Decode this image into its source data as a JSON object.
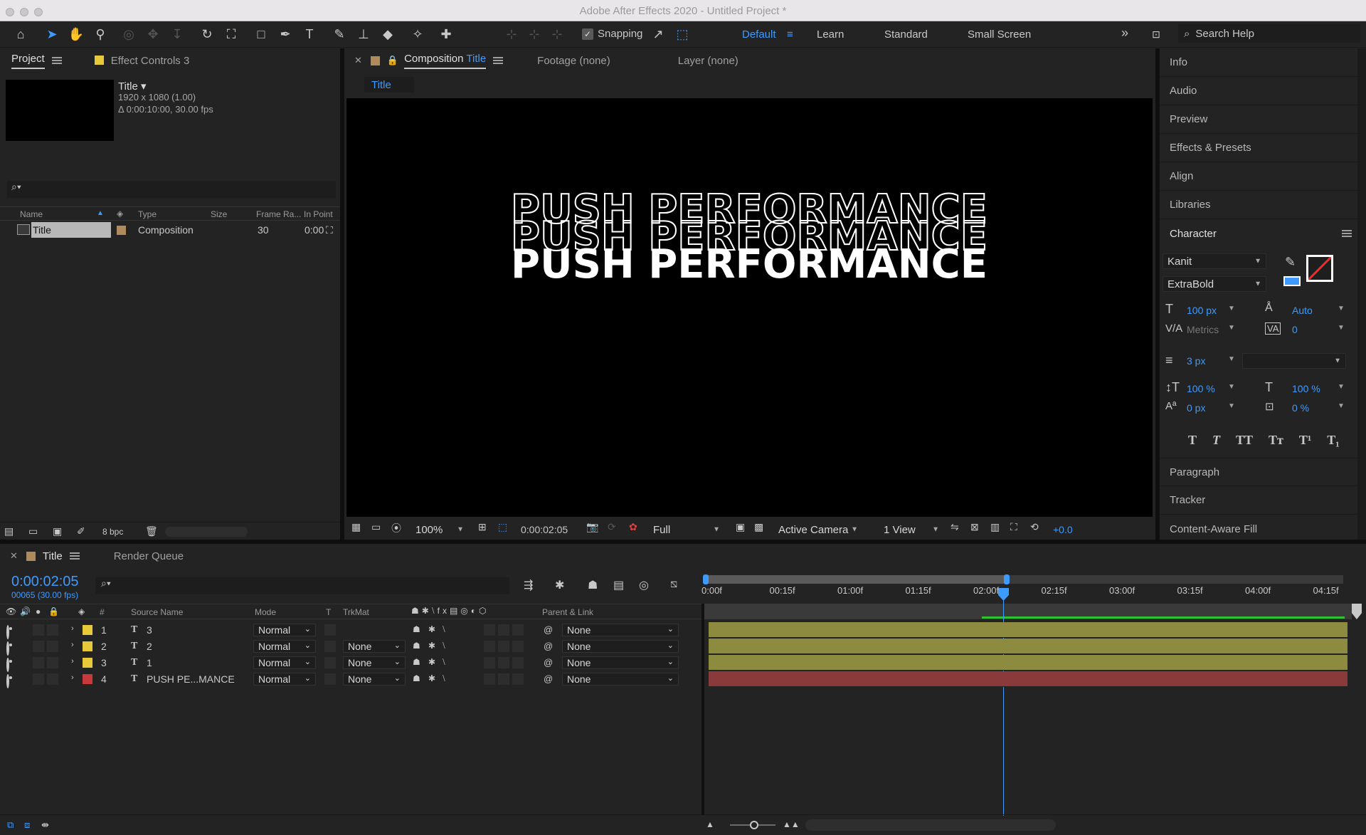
{
  "window": {
    "title": "Adobe After Effects 2020 - Untitled Project *"
  },
  "toolbar": {
    "snapping_label": "Snapping",
    "workspaces": [
      "Default",
      "Learn",
      "Standard",
      "Small Screen"
    ],
    "active_workspace": "Default",
    "more_icon": "»",
    "search_placeholder": "Search Help"
  },
  "project_panel": {
    "tab_project": "Project",
    "tab_effect_controls": "Effect Controls 3",
    "comp_name": "Title ▾",
    "comp_res": "1920 x 1080 (1.00)",
    "comp_dur": "Δ 0:00:10:00, 30.00 fps",
    "columns": [
      "Name",
      "Type",
      "Size",
      "Frame Ra...",
      "In Point"
    ],
    "items": [
      {
        "name": "Title",
        "type": "Composition",
        "frame_rate": "30",
        "in_point": "0:00"
      }
    ],
    "bpc": "8 bpc"
  },
  "viewer": {
    "tab_composition_prefix": "Composition",
    "tab_composition_name": "Title",
    "tab_footage": "Footage (none)",
    "tab_layer": "Layer (none)",
    "breadcrumb": "Title",
    "text_lines": [
      "PUSH PERFORMANCE",
      "PUSH PERFORMANCE",
      "PUSH PERFORMANCE"
    ],
    "zoom": "100%",
    "timecode": "0:00:02:05",
    "resolution": "Full",
    "camera": "Active Camera",
    "views": "1 View",
    "exposure": "+0.0"
  },
  "right_panel": {
    "items_top": [
      "Info",
      "Audio",
      "Preview",
      "Effects & Presets",
      "Align",
      "Libraries"
    ],
    "character_title": "Character",
    "font_family": "Kanit",
    "font_style": "ExtraBold",
    "font_size": "100 px",
    "leading": "Auto",
    "kerning": "Metrics",
    "tracking": "0",
    "stroke_width": "3 px",
    "vscale": "100 %",
    "hscale": "100 %",
    "baseline": "0 px",
    "tsume": "0 %",
    "style_buttons": [
      "T",
      "T",
      "TT",
      "Tт",
      "T¹",
      "T₁"
    ],
    "items_bottom": [
      "Paragraph",
      "Tracker",
      "Content-Aware Fill"
    ]
  },
  "timeline": {
    "tab_title": "Title",
    "tab_render": "Render Queue",
    "current_time": "0:00:02:05",
    "frame_info": "00065 (30.00 fps)",
    "columns": [
      "Source Name",
      "Mode",
      "T",
      "TrkMat",
      "Parent & Link"
    ],
    "num_header": "#",
    "layers": [
      {
        "num": "1",
        "name": "3",
        "mode": "Normal",
        "trkmat": "",
        "parent": "None",
        "color": "#e8c93a"
      },
      {
        "num": "2",
        "name": "2",
        "mode": "Normal",
        "trkmat": "None",
        "parent": "None",
        "color": "#e8c93a"
      },
      {
        "num": "3",
        "name": "1",
        "mode": "Normal",
        "trkmat": "None",
        "parent": "None",
        "color": "#e8c93a"
      },
      {
        "num": "4",
        "name": "PUSH PE...MANCE",
        "mode": "Normal",
        "trkmat": "None",
        "parent": "None",
        "color": "#c83a3a"
      }
    ],
    "ruler": [
      "0:00f",
      "00:15f",
      "01:00f",
      "01:15f",
      "02:00f",
      "02:15f",
      "03:00f",
      "03:15f",
      "04:00f",
      "04:15f"
    ]
  },
  "colors": {
    "accent": "#3d9bff",
    "bar_yellow": "#8c8b3f",
    "bar_red": "#8a3a3a"
  }
}
